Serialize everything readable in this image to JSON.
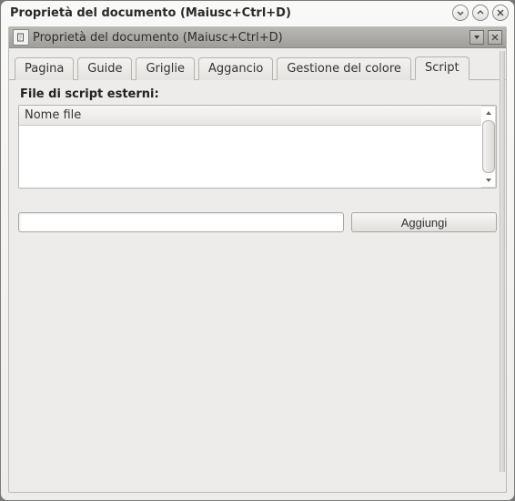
{
  "window": {
    "title": "Proprietà del documento (Maiusc+Ctrl+D)"
  },
  "panel": {
    "title": "Proprietà del documento (Maiusc+Ctrl+D)"
  },
  "tabs": [
    {
      "label": "Pagina"
    },
    {
      "label": "Guide"
    },
    {
      "label": "Griglie"
    },
    {
      "label": "Aggancio"
    },
    {
      "label": "Gestione del colore"
    },
    {
      "label": "Script"
    }
  ],
  "active_tab_index": 5,
  "script_tab": {
    "section_label": "File di script esterni:",
    "column_header": "Nome file",
    "rows": [],
    "new_path_value": "",
    "add_button_label": "Aggiungi"
  }
}
